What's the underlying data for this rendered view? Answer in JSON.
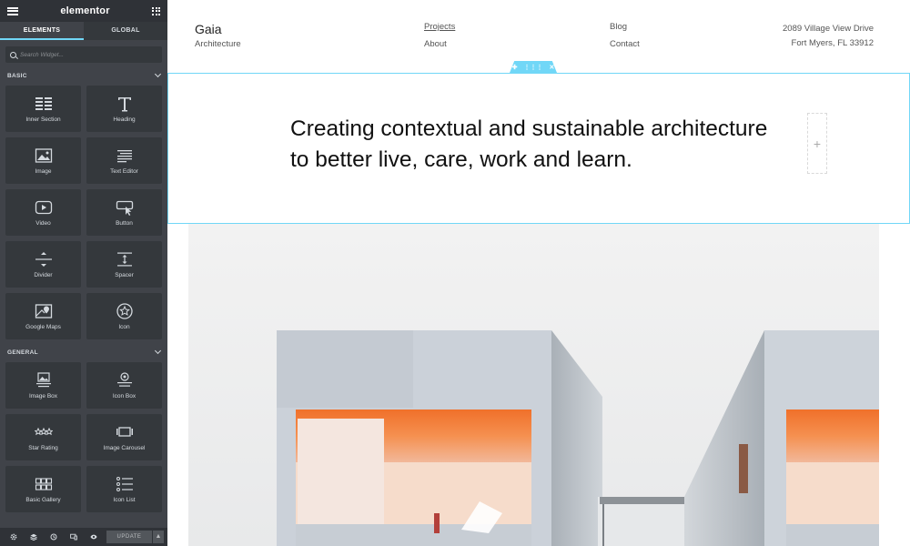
{
  "app": {
    "logo": "elementor",
    "tabs": [
      "ELEMENTS",
      "GLOBAL"
    ],
    "search_placeholder": "Search Widget...",
    "categories": [
      {
        "name": "BASIC",
        "widgets": [
          {
            "label": "Inner Section",
            "icon": "inner-section-icon"
          },
          {
            "label": "Heading",
            "icon": "heading-icon"
          },
          {
            "label": "Image",
            "icon": "image-icon"
          },
          {
            "label": "Text Editor",
            "icon": "text-editor-icon"
          },
          {
            "label": "Video",
            "icon": "video-icon"
          },
          {
            "label": "Button",
            "icon": "button-icon"
          },
          {
            "label": "Divider",
            "icon": "divider-icon"
          },
          {
            "label": "Spacer",
            "icon": "spacer-icon"
          },
          {
            "label": "Google Maps",
            "icon": "google-maps-icon"
          },
          {
            "label": "Icon",
            "icon": "star-circle-icon"
          }
        ]
      },
      {
        "name": "GENERAL",
        "widgets": [
          {
            "label": "Image Box",
            "icon": "image-box-icon"
          },
          {
            "label": "Icon Box",
            "icon": "icon-box-icon"
          },
          {
            "label": "Star Rating",
            "icon": "star-rating-icon"
          },
          {
            "label": "Image Carousel",
            "icon": "image-carousel-icon"
          },
          {
            "label": "Basic Gallery",
            "icon": "basic-gallery-icon"
          },
          {
            "label": "Icon List",
            "icon": "icon-list-icon"
          }
        ]
      }
    ],
    "footer": {
      "update_label": "UPDATE",
      "icons": [
        "settings-icon",
        "layers-icon",
        "history-icon",
        "responsive-icon",
        "preview-eye-icon"
      ]
    }
  },
  "site": {
    "brand_name": "Gaia",
    "brand_sub": "Architecture",
    "nav": [
      "Projects",
      "About",
      "Blog",
      "Contact"
    ],
    "address_line1": "2089 Village View Drive",
    "address_line2": "Fort Myers, FL 33912",
    "heading_line1": "Creating contextual and sustainable architecture",
    "heading_line2": "to better live, care, work and learn."
  },
  "colors": {
    "panel": "#404349",
    "panel_dark": "#2f3237",
    "accent": "#71d7f7"
  }
}
